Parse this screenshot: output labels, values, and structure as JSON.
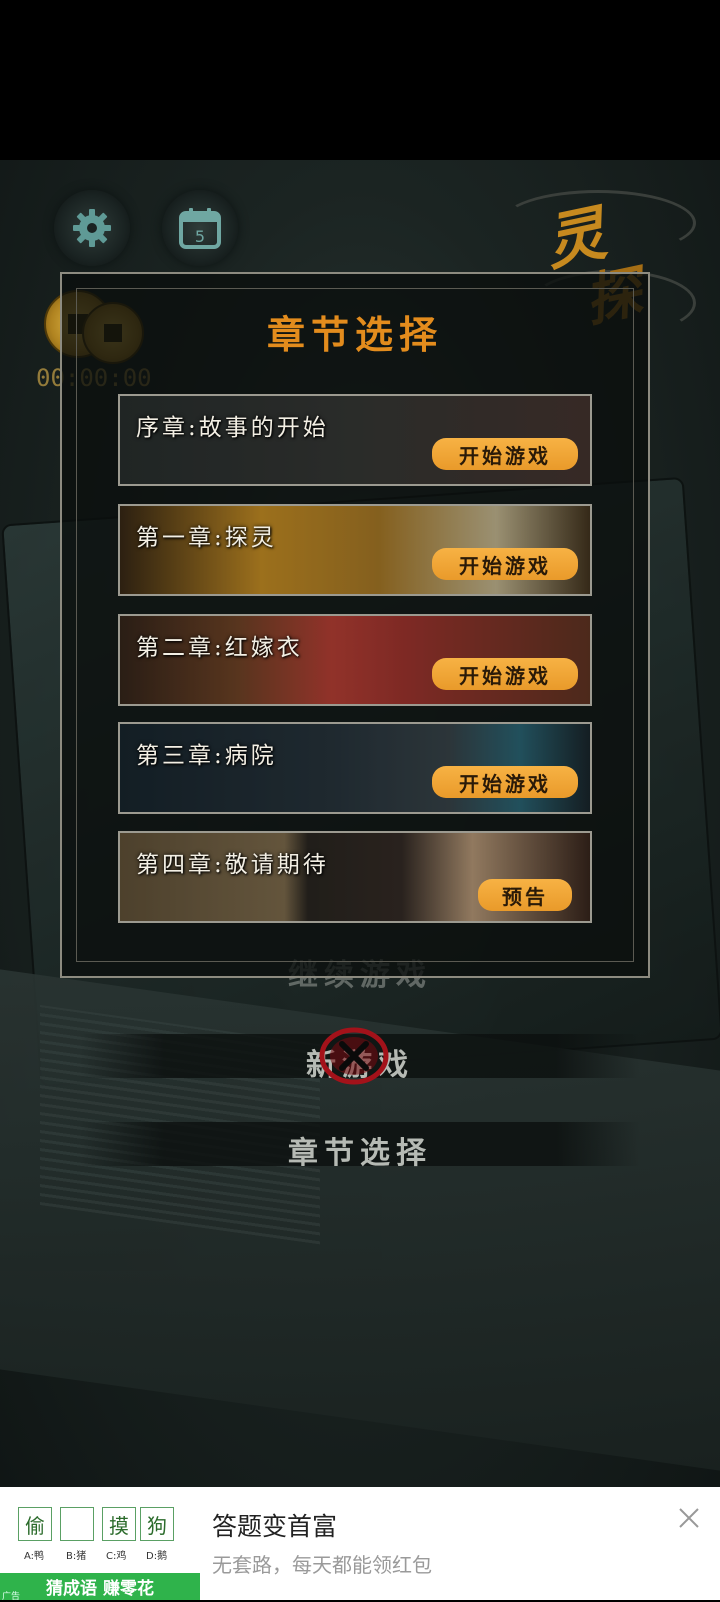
{
  "hud": {
    "calendar_day": "5",
    "timer": "00:00:00"
  },
  "logo": {
    "char1": "灵",
    "char2": "探"
  },
  "dialog": {
    "title": "章节选择",
    "chapters": [
      {
        "name": "序章:故事的开始",
        "button": "开始游戏"
      },
      {
        "name": "第一章:探灵",
        "button": "开始游戏"
      },
      {
        "name": "第二章:红嫁衣",
        "button": "开始游戏"
      },
      {
        "name": "第三章:病院",
        "button": "开始游戏"
      },
      {
        "name": "第四章:敬请期待",
        "button": "预告"
      }
    ]
  },
  "menu": {
    "continue": "继续游戏",
    "new_game": "新游戏",
    "chapter_select": "章节选择"
  },
  "ad": {
    "cells": [
      "偷",
      "",
      "摸",
      "狗"
    ],
    "options": [
      "A:鸭",
      "B:猪",
      "C:鸡",
      "D:鹅"
    ],
    "banner": "猜成语 赚零花",
    "tag": "广告",
    "title": "答题变首富",
    "subtitle": "无套路，每天都能领红包"
  },
  "colors": {
    "accent_orange": "#e38c1d",
    "button_orange": "#f0a535",
    "ad_green": "#2fb34b"
  }
}
